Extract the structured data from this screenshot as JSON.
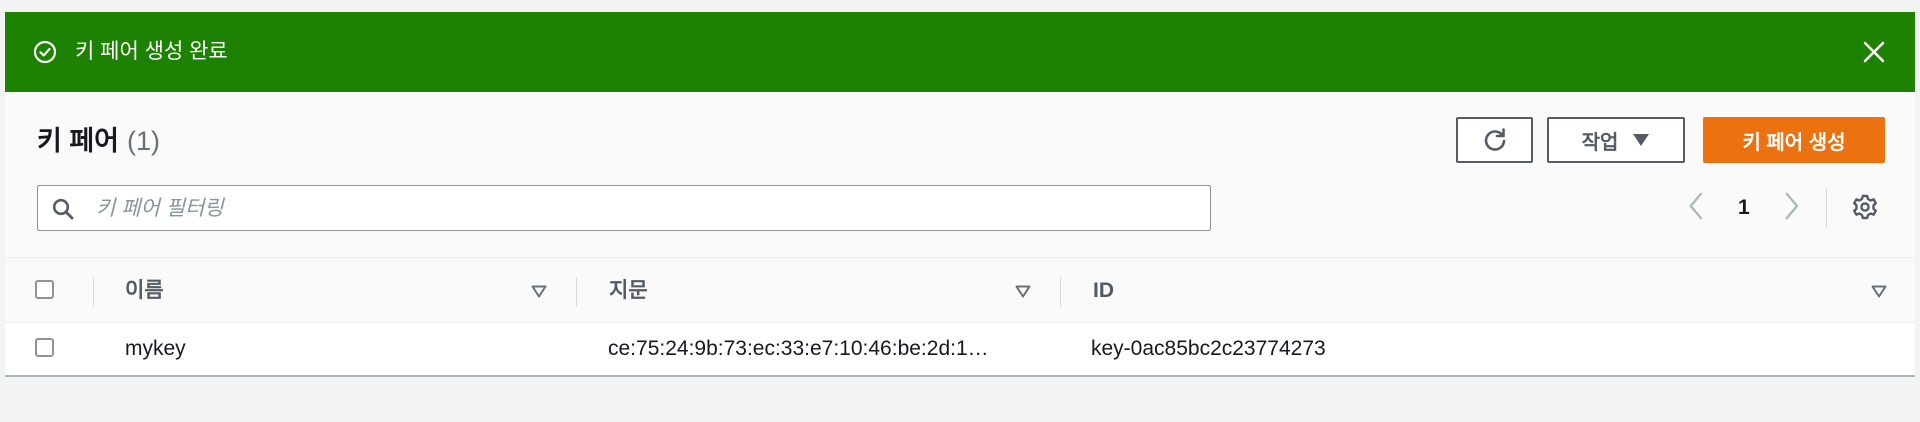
{
  "flash": {
    "message": "키 페어 생성 완료",
    "color": "#1d8102"
  },
  "header": {
    "title": "키 페어",
    "count": "(1)",
    "actions_label": "작업",
    "create_label": "키 페어 생성",
    "accent_color": "#ec7211"
  },
  "search": {
    "placeholder": "키 페어 필터링",
    "value": ""
  },
  "pagination": {
    "current_page": "1"
  },
  "table": {
    "columns": [
      "이름",
      "지문",
      "ID"
    ],
    "rows": [
      {
        "name": "mykey",
        "fingerprint": "ce:75:24:9b:73:ec:33:e7:10:46:be:2d:1…",
        "id": "key-0ac85bc2c23774273"
      }
    ]
  },
  "icons": [
    "check-circle-icon",
    "close-icon",
    "refresh-icon",
    "caret-down-icon",
    "search-icon",
    "chevron-left-icon",
    "chevron-right-icon",
    "gear-icon",
    "sort-icon"
  ]
}
